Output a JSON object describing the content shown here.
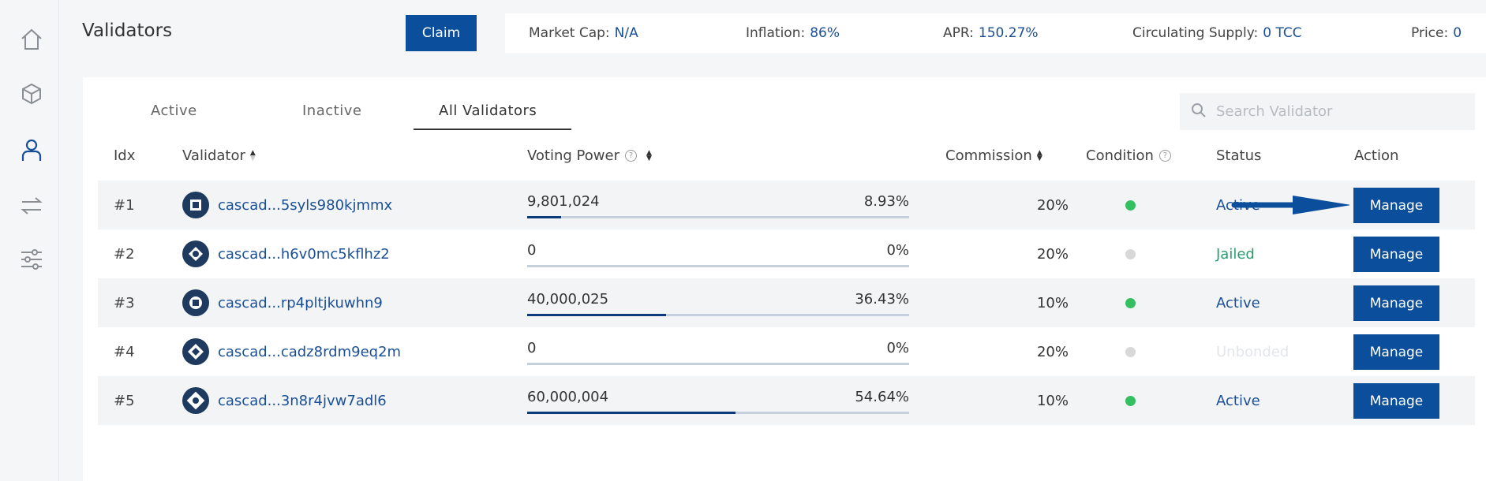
{
  "sidebar": {
    "items": [
      {
        "icon": "home-icon"
      },
      {
        "icon": "cube-icon"
      },
      {
        "icon": "user-icon",
        "active": true
      },
      {
        "icon": "transfer-icon"
      },
      {
        "icon": "sliders-icon"
      }
    ]
  },
  "header": {
    "title": "Validators",
    "claim_label": "Claim"
  },
  "stats": {
    "market_cap": {
      "label": "Market Cap:",
      "value": "N/A"
    },
    "inflation": {
      "label": "Inflation:",
      "value": "86%"
    },
    "apr": {
      "label": "APR:",
      "value": "150.27%"
    },
    "circulating_supply": {
      "label": "Circulating Supply:",
      "value": "0 TCC"
    },
    "price": {
      "label": "Price:",
      "value": "0"
    }
  },
  "tabs": [
    {
      "label": "Active"
    },
    {
      "label": "Inactive"
    },
    {
      "label": "All Validators",
      "active": true
    }
  ],
  "search": {
    "placeholder": "Search Validator"
  },
  "table": {
    "headers": {
      "idx": "Idx",
      "validator": "Validator",
      "voting_power": "Voting Power",
      "commission": "Commission",
      "condition": "Condition",
      "status": "Status",
      "action": "Action"
    },
    "rows": [
      {
        "idx": "#1",
        "validator": "cascad...5syls980kjmmx",
        "voting_power": "9,801,024",
        "voting_pct": "8.93%",
        "voting_fraction": 0.0893,
        "commission": "20%",
        "condition": "good",
        "status": "Active",
        "action": "Manage"
      },
      {
        "idx": "#2",
        "validator": "cascad...h6v0mc5kflhz2",
        "voting_power": "0",
        "voting_pct": "0%",
        "voting_fraction": 0,
        "commission": "20%",
        "condition": "none",
        "status": "Jailed",
        "action": "Manage"
      },
      {
        "idx": "#3",
        "validator": "cascad...rp4pltjkuwhn9",
        "voting_power": "40,000,025",
        "voting_pct": "36.43%",
        "voting_fraction": 0.3643,
        "commission": "10%",
        "condition": "good",
        "status": "Active",
        "action": "Manage"
      },
      {
        "idx": "#4",
        "validator": "cascad...cadz8rdm9eq2m",
        "voting_power": "0",
        "voting_pct": "0%",
        "voting_fraction": 0,
        "commission": "20%",
        "condition": "none",
        "status": "Unbonded",
        "action": "Manage"
      },
      {
        "idx": "#5",
        "validator": "cascad...3n8r4jvw7adl6",
        "voting_power": "60,000,004",
        "voting_pct": "54.64%",
        "voting_fraction": 0.5464,
        "commission": "10%",
        "condition": "good",
        "status": "Active",
        "action": "Manage"
      }
    ]
  },
  "colors": {
    "primary": "#0b4f9c",
    "link": "#1a4f96",
    "active_status": "#1a4f96",
    "jailed_status": "#2a9d6e",
    "unbonded_status": "#e3e6ea",
    "condition_good": "#34c061",
    "condition_none": "#d8d8d8"
  }
}
